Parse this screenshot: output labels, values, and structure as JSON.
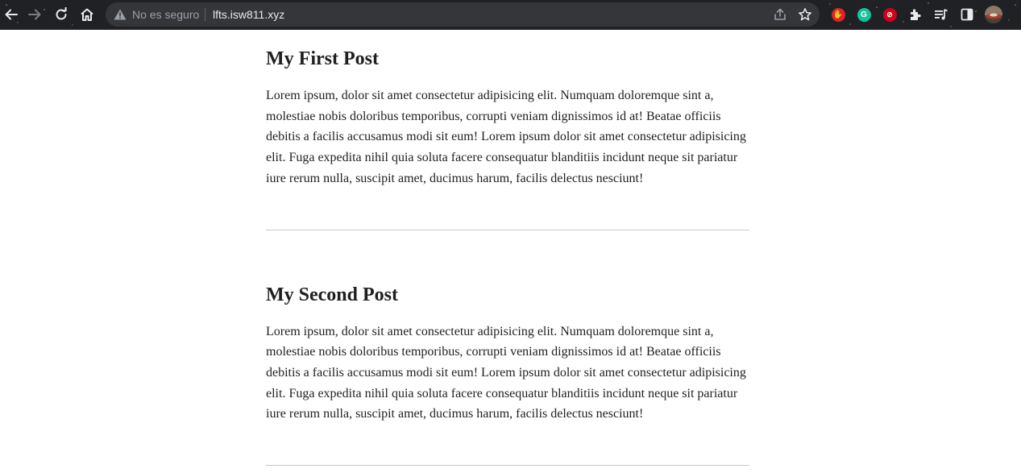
{
  "browser": {
    "security_label": "No es seguro",
    "url": "lfts.isw811.xyz",
    "icons": {
      "back": "back-arrow-icon",
      "forward": "forward-arrow-icon",
      "reload": "reload-icon",
      "home": "home-icon",
      "warning": "warning-triangle-icon",
      "share": "share-icon",
      "bookmark": "star-icon"
    },
    "extensions": [
      {
        "name": "red-hand-extension-icon",
        "color": "#e02424"
      },
      {
        "name": "grammarly-extension-icon",
        "letter": "G",
        "color": "#15c39a"
      },
      {
        "name": "red-block-extension-icon",
        "color": "#d0021b"
      },
      {
        "name": "puzzle-extensions-icon",
        "color": "#e8eaed"
      },
      {
        "name": "media-control-icon",
        "color": "#e8eaed"
      },
      {
        "name": "side-panel-icon",
        "color": "#e8eaed"
      },
      {
        "name": "profile-avatar",
        "color": "#7a6a5a"
      }
    ]
  },
  "posts": [
    {
      "title": "My First Post",
      "body": "Lorem ipsum, dolor sit amet consectetur adipisicing elit. Numquam doloremque sint a, molestiae nobis doloribus temporibus, corrupti veniam dignissimos id at! Beatae officiis debitis a facilis accusamus modi sit eum! Lorem ipsum dolor sit amet consectetur adipisicing elit. Fuga expedita nihil quia soluta facere consequatur blanditiis incidunt neque sit pariatur iure rerum nulla, suscipit amet, ducimus harum, facilis delectus nesciunt!"
    },
    {
      "title": "My Second Post",
      "body": "Lorem ipsum, dolor sit amet consectetur adipisicing elit. Numquam doloremque sint a, molestiae nobis doloribus temporibus, corrupti veniam dignissimos id at! Beatae officiis debitis a facilis accusamus modi sit eum! Lorem ipsum dolor sit amet consectetur adipisicing elit. Fuga expedita nihil quia soluta facere consequatur blanditiis incidunt neque sit pariatur iure rerum nulla, suscipit amet, ducimus harum, facilis delectus nesciunt!"
    }
  ]
}
